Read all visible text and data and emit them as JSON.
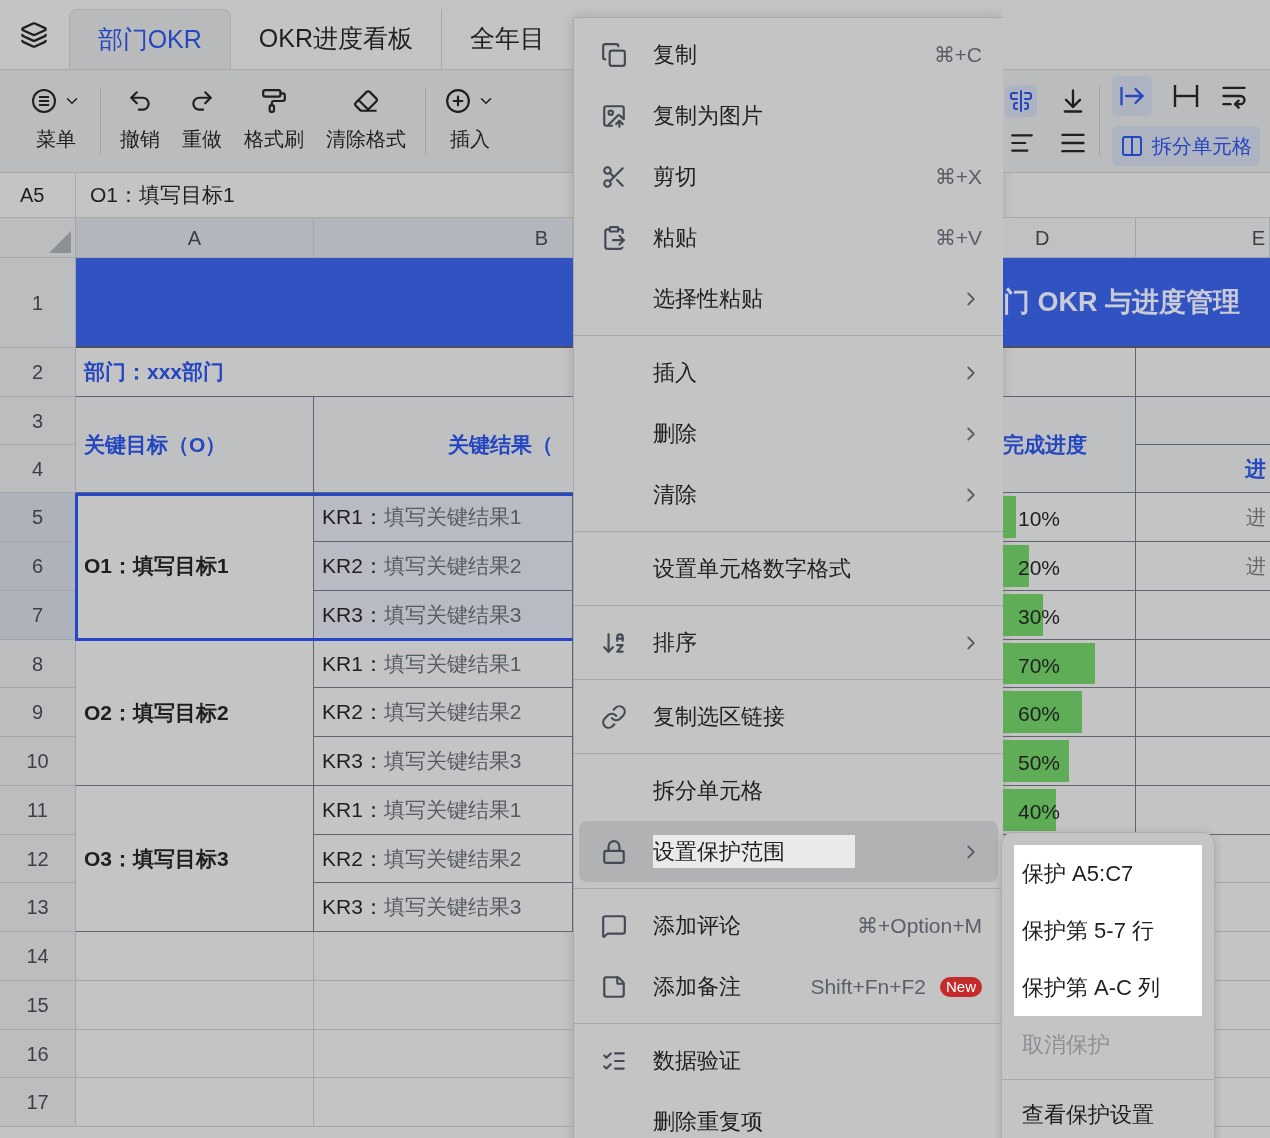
{
  "tabs": [
    {
      "label": "部门OKR",
      "selected": true
    },
    {
      "label": "OKR进度看板",
      "selected": false
    },
    {
      "label": "全年目",
      "selected": false
    }
  ],
  "toolbar": [
    {
      "kind": "menu",
      "label": "菜单",
      "dropdown": true,
      "divider_after": true
    },
    {
      "kind": "undo",
      "label": "撤销",
      "dropdown": false,
      "divider_after": false
    },
    {
      "kind": "redo",
      "label": "重做",
      "dropdown": false,
      "divider_after": false
    },
    {
      "kind": "painter",
      "label": "格式刷",
      "dropdown": false,
      "divider_after": false
    },
    {
      "kind": "clear",
      "label": "清除格式",
      "dropdown": false,
      "divider_after": true
    },
    {
      "kind": "insert",
      "label": "插入",
      "dropdown": true,
      "divider_after": false
    }
  ],
  "toolbar_right": {
    "split_label": "拆分单元格"
  },
  "formula_bar": {
    "cell": "A5",
    "value": "O1：填写目标1"
  },
  "columns_left": [
    "A",
    "B"
  ],
  "columns_right": [
    "D",
    "E"
  ],
  "row_headers": [
    {
      "label": "1",
      "selected": false
    },
    {
      "label": "2",
      "selected": false
    },
    {
      "label": "3",
      "selected": false
    },
    {
      "label": "4",
      "selected": false
    },
    {
      "label": "5",
      "selected": true
    },
    {
      "label": "6",
      "selected": true
    },
    {
      "label": "7",
      "selected": true
    },
    {
      "label": "8",
      "selected": false
    },
    {
      "label": "9",
      "selected": false
    },
    {
      "label": "10",
      "selected": false
    },
    {
      "label": "11",
      "selected": false
    },
    {
      "label": "12",
      "selected": false
    },
    {
      "label": "13",
      "selected": false
    },
    {
      "label": "14",
      "selected": false
    },
    {
      "label": "15",
      "selected": false
    },
    {
      "label": "16",
      "selected": false
    },
    {
      "label": "17",
      "selected": false
    }
  ],
  "sheet": {
    "title": "门 OKR 与进度管理",
    "department": "部门：xxx部门",
    "header_objective": "关键目标（O）",
    "header_key_results": "关键结果（",
    "header_progress": "完成进度",
    "header_column_e": "进",
    "objectives": [
      {
        "label": "O1：填写目标1",
        "key_results": [
          {
            "prefix": "KR1：",
            "text": "填写关键结果1"
          },
          {
            "prefix": "KR2：",
            "text": "填写关键结果2"
          },
          {
            "prefix": "KR3：",
            "text": "填写关键结果3"
          }
        ]
      },
      {
        "label": "O2：填写目标2",
        "key_results": [
          {
            "prefix": "KR1：",
            "text": "填写关键结果1"
          },
          {
            "prefix": "KR2：",
            "text": "填写关键结果2"
          },
          {
            "prefix": "KR3：",
            "text": "填写关键结果3"
          }
        ]
      },
      {
        "label": "O3：填写目标3",
        "key_results": [
          {
            "prefix": "KR1：",
            "text": "填写关键结果1"
          },
          {
            "prefix": "KR2：",
            "text": "填写关键结果2"
          },
          {
            "prefix": "KR3：",
            "text": "填写关键结果3"
          }
        ]
      }
    ],
    "progress": [
      {
        "reading": "10%",
        "level": 0.1,
        "note": "进"
      },
      {
        "reading": "20%",
        "level": 0.2,
        "note": "进"
      },
      {
        "reading": "30%",
        "level": 0.3
      },
      {
        "reading": "70%",
        "level": 0.7
      },
      {
        "reading": "60%",
        "level": 0.6
      },
      {
        "reading": "50%",
        "level": 0.5
      },
      {
        "reading": "40%",
        "level": 0.4
      }
    ]
  },
  "menu": {
    "groups": [
      [
        {
          "kind": "copy",
          "label": "复制",
          "shortcut": "⌘+C",
          "submenu": false,
          "selected": false
        },
        {
          "kind": "image",
          "label": "复制为图片",
          "submenu": false,
          "selected": false
        },
        {
          "kind": "scissors",
          "label": "剪切",
          "shortcut": "⌘+X",
          "submenu": false,
          "selected": false
        },
        {
          "kind": "paste",
          "label": "粘贴",
          "shortcut": "⌘+V",
          "submenu": false,
          "selected": false
        },
        {
          "label": "选择性粘贴",
          "submenu": true,
          "selected": false
        }
      ],
      [
        {
          "label": "插入",
          "submenu": true,
          "selected": false
        },
        {
          "label": "删除",
          "submenu": true,
          "selected": false
        },
        {
          "label": "清除",
          "submenu": true,
          "selected": false
        }
      ],
      [
        {
          "label": "设置单元格数字格式",
          "submenu": false,
          "selected": false
        }
      ],
      [
        {
          "kind": "sort",
          "label": "排序",
          "submenu": true,
          "selected": false
        }
      ],
      [
        {
          "kind": "link",
          "label": "复制选区链接",
          "submenu": false,
          "selected": false
        }
      ],
      [
        {
          "label": "拆分单元格",
          "submenu": false,
          "selected": false
        },
        {
          "kind": "lock",
          "label": "设置保护范围",
          "submenu": true,
          "selected": true
        }
      ],
      [
        {
          "kind": "comment",
          "label": "添加评论",
          "shortcut": "⌘+Option+M",
          "submenu": false,
          "selected": false
        },
        {
          "kind": "note",
          "label": "添加备注",
          "shortcut": "Shift+Fn+F2",
          "badge": "New",
          "submenu": false,
          "selected": false
        }
      ],
      [
        {
          "kind": "validate",
          "label": "数据验证",
          "submenu": false,
          "selected": false
        },
        {
          "label": "删除重复项",
          "submenu": false,
          "selected": false
        }
      ]
    ]
  },
  "submenu": {
    "sections": [
      {
        "highlighted": true,
        "divided": false,
        "items": [
          {
            "label": "保护 A5:C7",
            "disabled": false
          },
          {
            "label": "保护第 5-7 行",
            "disabled": false
          },
          {
            "label": "保护第 A-C 列",
            "disabled": false
          }
        ]
      },
      {
        "highlighted": false,
        "divided": false,
        "items": [
          {
            "label": "取消保护",
            "disabled": true
          }
        ]
      },
      {
        "highlighted": false,
        "divided": true,
        "items": [
          {
            "label": "查看保护设置",
            "disabled": false
          }
        ]
      }
    ]
  }
}
